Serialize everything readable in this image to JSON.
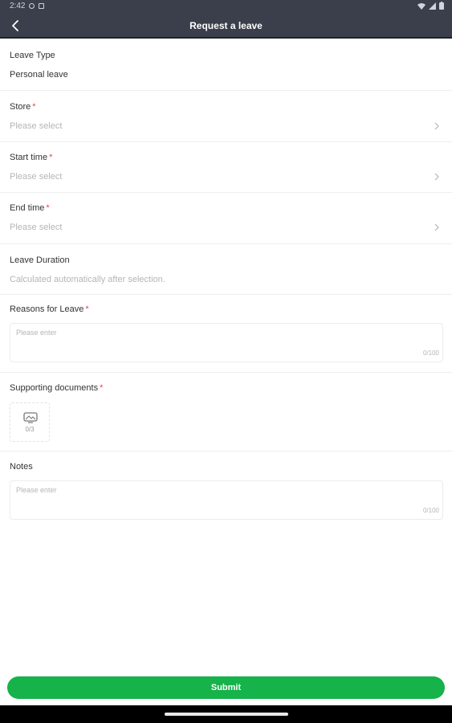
{
  "status_bar": {
    "time": "2:42"
  },
  "header": {
    "title": "Request a leave",
    "back_icon": "chevron-left-icon"
  },
  "form": {
    "leave_type": {
      "label": "Leave Type",
      "value": "Personal leave"
    },
    "store": {
      "label": "Store",
      "required": "*",
      "placeholder": "Please select"
    },
    "start_time": {
      "label": "Start time",
      "required": "*",
      "placeholder": "Please select"
    },
    "end_time": {
      "label": "End time",
      "required": "*",
      "placeholder": "Please select"
    },
    "leave_duration": {
      "label": "Leave Duration",
      "value": "Calculated automatically after selection."
    },
    "reasons": {
      "label": "Reasons for Leave",
      "required": "*",
      "placeholder": "Please enter",
      "counter": "0/100"
    },
    "supporting_documents": {
      "label": "Supporting documents",
      "required": "*",
      "counter": "0/3",
      "icon": "image-upload-icon"
    },
    "notes": {
      "label": "Notes",
      "placeholder": "Please enter",
      "counter": "0/100"
    }
  },
  "submit_label": "Submit",
  "colors": {
    "header_bg": "#3a3f4b",
    "accent_green": "#16b24a",
    "required_red": "#e5484d"
  }
}
